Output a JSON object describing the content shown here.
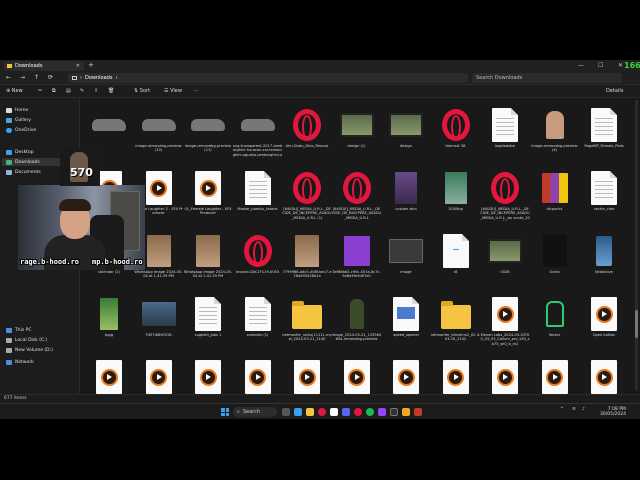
{
  "window": {
    "tab_title": "Downloads",
    "new_tab": "+",
    "controls": [
      "—",
      "☐",
      "✕"
    ]
  },
  "nav": {
    "back": "←",
    "forward": "→",
    "up": "↑",
    "refresh": "⟳",
    "address_parts": [
      "›",
      "Downloads",
      "›"
    ],
    "search_placeholder": "Search Downloads"
  },
  "overlay_counter": "166",
  "toolbar": {
    "new": "New",
    "sort": "Sort",
    "view": "View",
    "more": "···",
    "details": "Details"
  },
  "sidebar": {
    "items": [
      {
        "label": "Home",
        "icon": "home-icon"
      },
      {
        "label": "Gallery",
        "icon": "gallery-icon"
      },
      {
        "label": "OneDrive",
        "icon": "cloud-icon"
      },
      {
        "label": "Desktop",
        "icon": "desktop-icon"
      },
      {
        "label": "Downloads",
        "icon": "download-icon"
      },
      {
        "label": "Documents",
        "icon": "document-icon"
      },
      {
        "label": "This PC",
        "icon": "pc-icon"
      },
      {
        "label": "Local Disk (C:)",
        "icon": "drive-icon"
      },
      {
        "label": "New Volume (D:)",
        "icon": "drive-icon"
      },
      {
        "label": "Network",
        "icon": "network-icon"
      }
    ]
  },
  "files": [
    {
      "name": "",
      "kind": "car"
    },
    {
      "name": "image-removebg-preview (10)",
      "kind": "car"
    },
    {
      "name": "image-removebg-preview (11)",
      "kind": "car"
    },
    {
      "name": "png-transparent-2017-lamborghini-huracan-car-lamborghini-aguista-lamborghini-aventador-la...",
      "kind": "car"
    },
    {
      "name": "Ahn-Dudu_Dino_Rescue",
      "kind": "opera"
    },
    {
      "name": "design (1)",
      "kind": "video"
    },
    {
      "name": "design",
      "kind": "video"
    },
    {
      "name": "teams# 38",
      "kind": "opera"
    },
    {
      "name": "legaladobe",
      "kind": "doc"
    },
    {
      "name": "image-removebg-preview (4)",
      "kind": "person"
    },
    {
      "name": "RageMP_Female_Peds",
      "kind": "doc"
    },
    {
      "name": "MSF (1)",
      "kind": "doc"
    },
    {
      "name": "",
      "kind": "play"
    },
    {
      "name": "Female Laughter 2 - SFX Producer",
      "kind": "play"
    },
    {
      "name": "01_Female Laughter - SFX Producer",
      "kind": "play"
    },
    {
      "name": "Master_pambu_listadx",
      "kind": "doc"
    },
    {
      "name": "[640DU]_MEDIA_U.R.L._DECIDE_DE_INCEPERE_ASAGU_MEDIA_U.R.L (1)",
      "kind": "opera"
    },
    {
      "name": "[640DU]_MEDIA_U.R.L._DECIDE_DE_INCEPERE_ASAGU_MEDIA_U.R.L",
      "kind": "opera"
    },
    {
      "name": "custom skin",
      "kind": "skin"
    },
    {
      "name": "1000fpp",
      "kind": "photo"
    },
    {
      "name": "[640DU]_MEDIA_U.R.L._DECIDE_DE_INCEPERE_ASAGU_MEDIA_U.R.L._bu zunte_2024",
      "kind": "opera"
    },
    {
      "name": "dlcpacks",
      "kind": "rar"
    },
    {
      "name": "vector_clee",
      "kind": "doc"
    },
    {
      "name": "",
      "kind": "play"
    },
    {
      "name": "calendar (2)",
      "kind": "skin"
    },
    {
      "name": "WhatsApp Image 2024-05-04 at 1.41.39 PM",
      "kind": "id"
    },
    {
      "name": "WhatsApp Image 2024-05-04 at 1.41.39 PM",
      "kind": "id"
    },
    {
      "name": "Invoice-D0C1F119-0003",
      "kind": "opera"
    },
    {
      "name": "7799968-a6c5-408f-bec7-e784d95428d1a",
      "kind": "id"
    },
    {
      "name": "3ef68bb3-c95c-457a-8c7c-9a8d4fe5d67e0",
      "kind": "purple"
    },
    {
      "name": "image",
      "kind": "screenshot"
    },
    {
      "name": "r8",
      "kind": "docblue"
    },
    {
      "name": "0026",
      "kind": "video"
    },
    {
      "name": "Outro",
      "kind": "dark"
    },
    {
      "name": "tiktoklove",
      "kind": "phone"
    },
    {
      "name": "",
      "kind": "play"
    },
    {
      "name": "tpgg",
      "kind": "game"
    },
    {
      "name": "TIKTOKBHOOD",
      "kind": "carphoto"
    },
    {
      "name": "sugestii_jobs 1",
      "kind": "doc"
    },
    {
      "name": "calendar (1)",
      "kind": "doc"
    },
    {
      "name": "netmonfer_radiu(11111-myel_2024-03-21_1140",
      "kind": "folder"
    },
    {
      "name": "image_2024-03-21_133564854-removebg-preview",
      "kind": "person2"
    },
    {
      "name": "speed_special",
      "kind": "docart"
    },
    {
      "name": "netmonfer_Idmsfnrs2_02 4-03-20_2142",
      "kind": "folder"
    },
    {
      "name": "Eleven Labs_2024-03-20T00_03_03_Callum_pre_s50_sb75_se0_b_m2",
      "kind": "play"
    },
    {
      "name": "Vector",
      "kind": "fist"
    },
    {
      "name": "Open button",
      "kind": "play"
    },
    {
      "name": "",
      "kind": "play"
    },
    {
      "name": "",
      "kind": "play"
    },
    {
      "name": "",
      "kind": "play"
    },
    {
      "name": "",
      "kind": "play"
    },
    {
      "name": "",
      "kind": "play"
    },
    {
      "name": "",
      "kind": "play"
    },
    {
      "name": "",
      "kind": "play"
    },
    {
      "name": "",
      "kind": "play"
    },
    {
      "name": "",
      "kind": "play"
    },
    {
      "name": "",
      "kind": "play"
    },
    {
      "name": "",
      "kind": "play"
    },
    {
      "name": "",
      "kind": "play"
    }
  ],
  "status": {
    "items": "677 items",
    "sep": "|"
  },
  "taskbar": {
    "search": "Search",
    "time": "7:08 PM",
    "date": "30/05/2024"
  },
  "webcam": {
    "overlay_left": "rage.b-hood.ro",
    "overlay_right": "mp.b-hood.ro",
    "small_number": "570"
  },
  "colors": {
    "explorer_bg": "#191919",
    "opera_red": "#e3163d",
    "folder_yellow": "#f5c542",
    "counter_green": "#3fd13f",
    "windows_blue": "#3ba0f0"
  }
}
